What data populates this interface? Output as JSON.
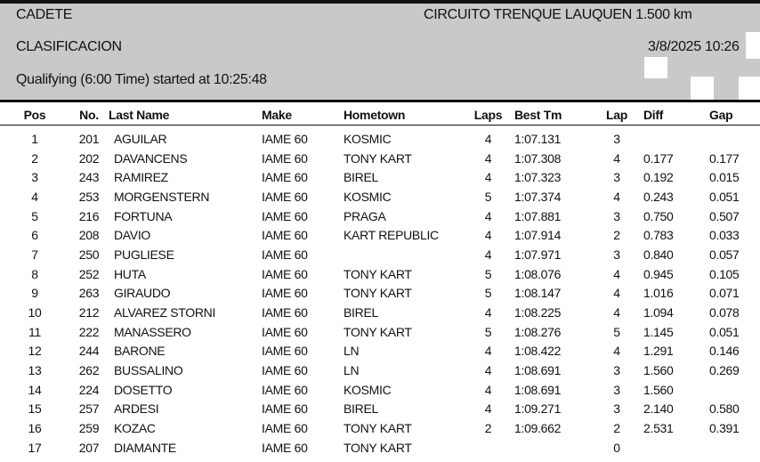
{
  "header": {
    "category": "CADETE",
    "circuit": "CIRCUITO TRENQUE LAUQUEN 1.500 km",
    "title": "CLASIFICACION",
    "datetime": "3/8/2025 10:26",
    "session": "Qualifying (6:00 Time) started at 10:25:48"
  },
  "columns": {
    "pos": "Pos",
    "no": "No.",
    "last_name": "Last Name",
    "make": "Make",
    "hometown": "Hometown",
    "laps": "Laps",
    "best_tm": "Best Tm",
    "lap": "Lap",
    "diff": "Diff",
    "gap": "Gap"
  },
  "rows": [
    {
      "pos": "1",
      "no": "201",
      "name": "AGUILAR",
      "make": "IAME 60",
      "hometown": "KOSMIC",
      "laps": "4",
      "best": "1:07.131",
      "lap": "3",
      "diff": "",
      "gap": ""
    },
    {
      "pos": "2",
      "no": "202",
      "name": "DAVANCENS",
      "make": "IAME 60",
      "hometown": "TONY KART",
      "laps": "4",
      "best": "1:07.308",
      "lap": "4",
      "diff": "0.177",
      "gap": "0.177"
    },
    {
      "pos": "3",
      "no": "243",
      "name": "RAMIREZ",
      "make": "IAME 60",
      "hometown": "BIREL",
      "laps": "4",
      "best": "1:07.323",
      "lap": "3",
      "diff": "0.192",
      "gap": "0.015"
    },
    {
      "pos": "4",
      "no": "253",
      "name": "MORGENSTERN",
      "make": "IAME 60",
      "hometown": "KOSMIC",
      "laps": "5",
      "best": "1:07.374",
      "lap": "4",
      "diff": "0.243",
      "gap": "0.051"
    },
    {
      "pos": "5",
      "no": "216",
      "name": "FORTUNA",
      "make": "IAME 60",
      "hometown": "PRAGA",
      "laps": "4",
      "best": "1:07.881",
      "lap": "3",
      "diff": "0.750",
      "gap": "0.507"
    },
    {
      "pos": "6",
      "no": "208",
      "name": "DAVIO",
      "make": "IAME 60",
      "hometown": "KART REPUBLIC",
      "laps": "4",
      "best": "1:07.914",
      "lap": "2",
      "diff": "0.783",
      "gap": "0.033"
    },
    {
      "pos": "7",
      "no": "250",
      "name": "PUGLIESE",
      "make": "IAME 60",
      "hometown": "",
      "laps": "4",
      "best": "1:07.971",
      "lap": "3",
      "diff": "0.840",
      "gap": "0.057"
    },
    {
      "pos": "8",
      "no": "252",
      "name": "HUTA",
      "make": "IAME 60",
      "hometown": "TONY KART",
      "laps": "5",
      "best": "1:08.076",
      "lap": "4",
      "diff": "0.945",
      "gap": "0.105"
    },
    {
      "pos": "9",
      "no": "263",
      "name": "GIRAUDO",
      "make": "IAME 60",
      "hometown": "TONY KART",
      "laps": "5",
      "best": "1:08.147",
      "lap": "4",
      "diff": "1.016",
      "gap": "0.071"
    },
    {
      "pos": "10",
      "no": "212",
      "name": "ALVAREZ STORNI",
      "make": "IAME 60",
      "hometown": "BIREL",
      "laps": "4",
      "best": "1:08.225",
      "lap": "4",
      "diff": "1.094",
      "gap": "0.078"
    },
    {
      "pos": "11",
      "no": "222",
      "name": "MANASSERO",
      "make": "IAME 60",
      "hometown": "TONY KART",
      "laps": "5",
      "best": "1:08.276",
      "lap": "5",
      "diff": "1.145",
      "gap": "0.051"
    },
    {
      "pos": "12",
      "no": "244",
      "name": "BARONE",
      "make": "IAME 60",
      "hometown": "LN",
      "laps": "4",
      "best": "1:08.422",
      "lap": "4",
      "diff": "1.291",
      "gap": "0.146"
    },
    {
      "pos": "13",
      "no": "262",
      "name": "BUSSALINO",
      "make": "IAME 60",
      "hometown": "LN",
      "laps": "4",
      "best": "1:08.691",
      "lap": "3",
      "diff": "1.560",
      "gap": "0.269"
    },
    {
      "pos": "14",
      "no": "224",
      "name": "DOSETTO",
      "make": "IAME 60",
      "hometown": "KOSMIC",
      "laps": "4",
      "best": "1:08.691",
      "lap": "3",
      "diff": "1.560",
      "gap": ""
    },
    {
      "pos": "15",
      "no": "257",
      "name": "ARDESI",
      "make": "IAME 60",
      "hometown": "BIREL",
      "laps": "4",
      "best": "1:09.271",
      "lap": "3",
      "diff": "2.140",
      "gap": "0.580"
    },
    {
      "pos": "16",
      "no": "259",
      "name": "KOZAC",
      "make": "IAME 60",
      "hometown": "TONY KART",
      "laps": "2",
      "best": "1:09.662",
      "lap": "2",
      "diff": "2.531",
      "gap": "0.391"
    },
    {
      "pos": "17",
      "no": "207",
      "name": "DIAMANTE",
      "make": "IAME 60",
      "hometown": "TONY KART",
      "laps": "",
      "best": "",
      "lap": "0",
      "diff": "",
      "gap": ""
    }
  ]
}
